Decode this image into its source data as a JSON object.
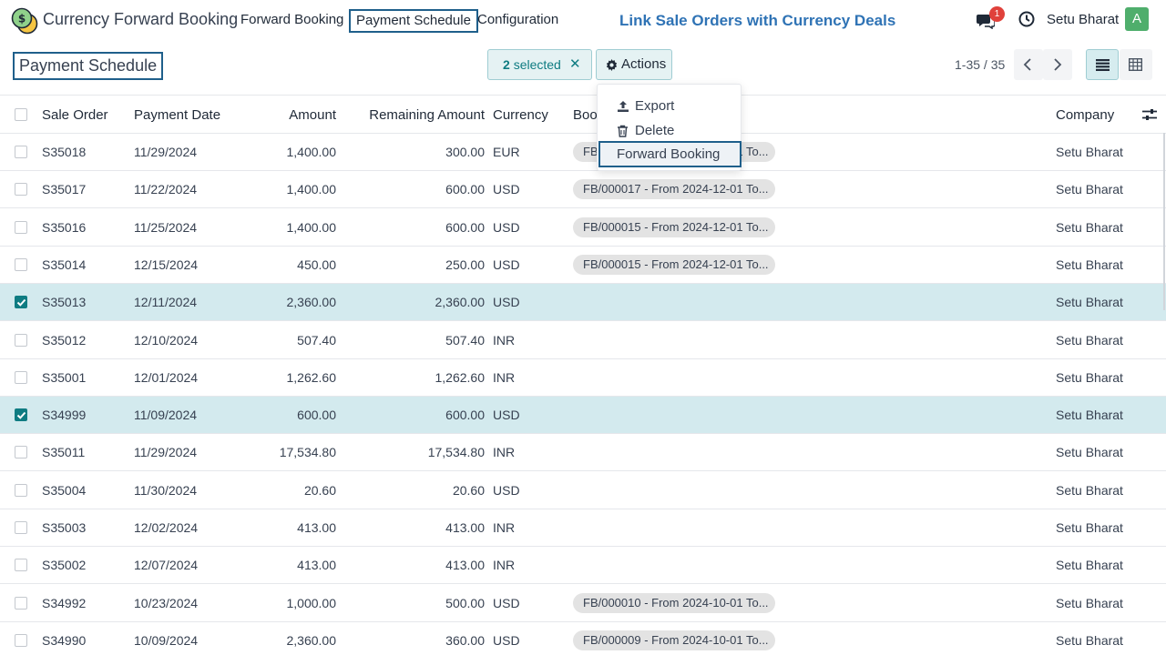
{
  "navbar": {
    "app_title": "Currency Forward Booking",
    "menu": [
      "Forward Booking",
      "Payment Schedule",
      "Configuration"
    ],
    "active_menu": "Payment Schedule",
    "promo": "Link Sale Orders with Currency Deals",
    "notification_count": "1",
    "user_name": "Setu Bharat",
    "avatar_letter": "A",
    "icons": [
      "coins-logo-icon",
      "chat-icon",
      "clock-icon"
    ]
  },
  "control_panel": {
    "breadcrumb": "Payment Schedule",
    "selected_count": "2",
    "selected_label": "selected",
    "clear_icon": "✕",
    "actions_label": "Actions",
    "pager": "1-35 / 35"
  },
  "actions_menu": {
    "items": [
      "Export",
      "Delete",
      "Forward Booking"
    ],
    "highlighted": "Forward Booking"
  },
  "table": {
    "columns": [
      "Sale Order",
      "Payment Date",
      "Amount",
      "Remaining Amount",
      "Currency",
      "Boo",
      "Company"
    ],
    "rows": [
      {
        "order": "S35018",
        "date": "11/29/2024",
        "amount": "1,400.00",
        "remaining": "300.00",
        "currency": "EUR",
        "booking": "FB/000018 - From 2024-12-01 To...",
        "company": "Setu Bharat",
        "selected": false
      },
      {
        "order": "S35017",
        "date": "11/22/2024",
        "amount": "1,400.00",
        "remaining": "600.00",
        "currency": "USD",
        "booking": "FB/000017 - From 2024-12-01 To...",
        "company": "Setu Bharat",
        "selected": false
      },
      {
        "order": "S35016",
        "date": "11/25/2024",
        "amount": "1,400.00",
        "remaining": "600.00",
        "currency": "USD",
        "booking": "FB/000015 - From 2024-12-01 To...",
        "company": "Setu Bharat",
        "selected": false
      },
      {
        "order": "S35014",
        "date": "12/15/2024",
        "amount": "450.00",
        "remaining": "250.00",
        "currency": "USD",
        "booking": "FB/000015 - From 2024-12-01 To...",
        "company": "Setu Bharat",
        "selected": false
      },
      {
        "order": "S35013",
        "date": "12/11/2024",
        "amount": "2,360.00",
        "remaining": "2,360.00",
        "currency": "USD",
        "booking": "",
        "company": "Setu Bharat",
        "selected": true
      },
      {
        "order": "S35012",
        "date": "12/10/2024",
        "amount": "507.40",
        "remaining": "507.40",
        "currency": "INR",
        "booking": "",
        "company": "Setu Bharat",
        "selected": false
      },
      {
        "order": "S35001",
        "date": "12/01/2024",
        "amount": "1,262.60",
        "remaining": "1,262.60",
        "currency": "INR",
        "booking": "",
        "company": "Setu Bharat",
        "selected": false
      },
      {
        "order": "S34999",
        "date": "11/09/2024",
        "amount": "600.00",
        "remaining": "600.00",
        "currency": "USD",
        "booking": "",
        "company": "Setu Bharat",
        "selected": true
      },
      {
        "order": "S35011",
        "date": "11/29/2024",
        "amount": "17,534.80",
        "remaining": "17,534.80",
        "currency": "INR",
        "booking": "",
        "company": "Setu Bharat",
        "selected": false
      },
      {
        "order": "S35004",
        "date": "11/30/2024",
        "amount": "20.60",
        "remaining": "20.60",
        "currency": "USD",
        "booking": "",
        "company": "Setu Bharat",
        "selected": false
      },
      {
        "order": "S35003",
        "date": "12/02/2024",
        "amount": "413.00",
        "remaining": "413.00",
        "currency": "INR",
        "booking": "",
        "company": "Setu Bharat",
        "selected": false
      },
      {
        "order": "S35002",
        "date": "12/07/2024",
        "amount": "413.00",
        "remaining": "413.00",
        "currency": "INR",
        "booking": "",
        "company": "Setu Bharat",
        "selected": false
      },
      {
        "order": "S34992",
        "date": "10/23/2024",
        "amount": "1,000.00",
        "remaining": "500.00",
        "currency": "USD",
        "booking": "FB/000010 - From 2024-10-01 To...",
        "company": "Setu Bharat",
        "selected": false
      },
      {
        "order": "S34990",
        "date": "10/09/2024",
        "amount": "2,360.00",
        "remaining": "360.00",
        "currency": "USD",
        "booking": "FB/000009 - From 2024-10-01 To...",
        "company": "Setu Bharat",
        "selected": false
      }
    ]
  },
  "colors": {
    "accent": "#0f7c82",
    "focus_border": "#1f5f8b",
    "selected_row": "#d3eaee",
    "promo_text": "#2f73b5",
    "badge": "#e0413b",
    "avatar": "#4fae6c"
  }
}
